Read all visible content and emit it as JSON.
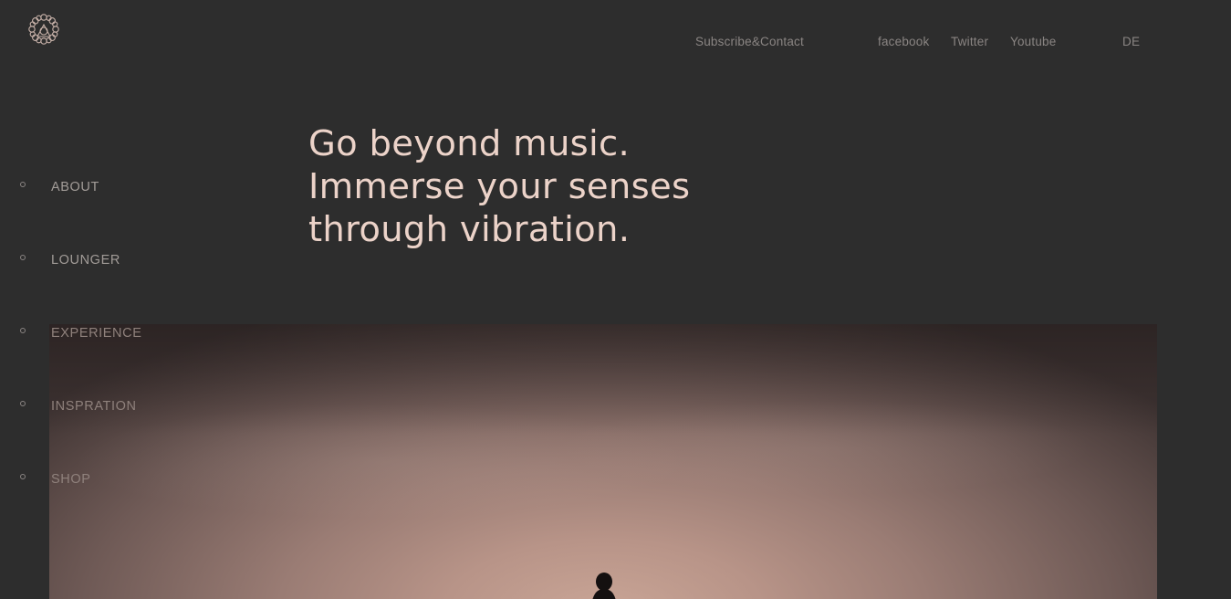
{
  "brand": {
    "logo_icon": "flower-knot-logo-icon",
    "accent_color": "#ecd3c9",
    "background_color": "#2d2d2d"
  },
  "topnav": {
    "subscribe_contact": "Subscribe&Contact",
    "facebook": "facebook",
    "twitter": "Twitter",
    "youtube": "Youtube",
    "language": "DE"
  },
  "sidenav": {
    "items": [
      {
        "label": "ABOUT"
      },
      {
        "label": "LOUNGER"
      },
      {
        "label": "EXPERIENCE"
      },
      {
        "label": "INSPRATION"
      },
      {
        "label": "SHOP"
      }
    ]
  },
  "hero": {
    "headline_lines": [
      "Go beyond music.",
      "Immerse your senses",
      "through vibration."
    ]
  }
}
